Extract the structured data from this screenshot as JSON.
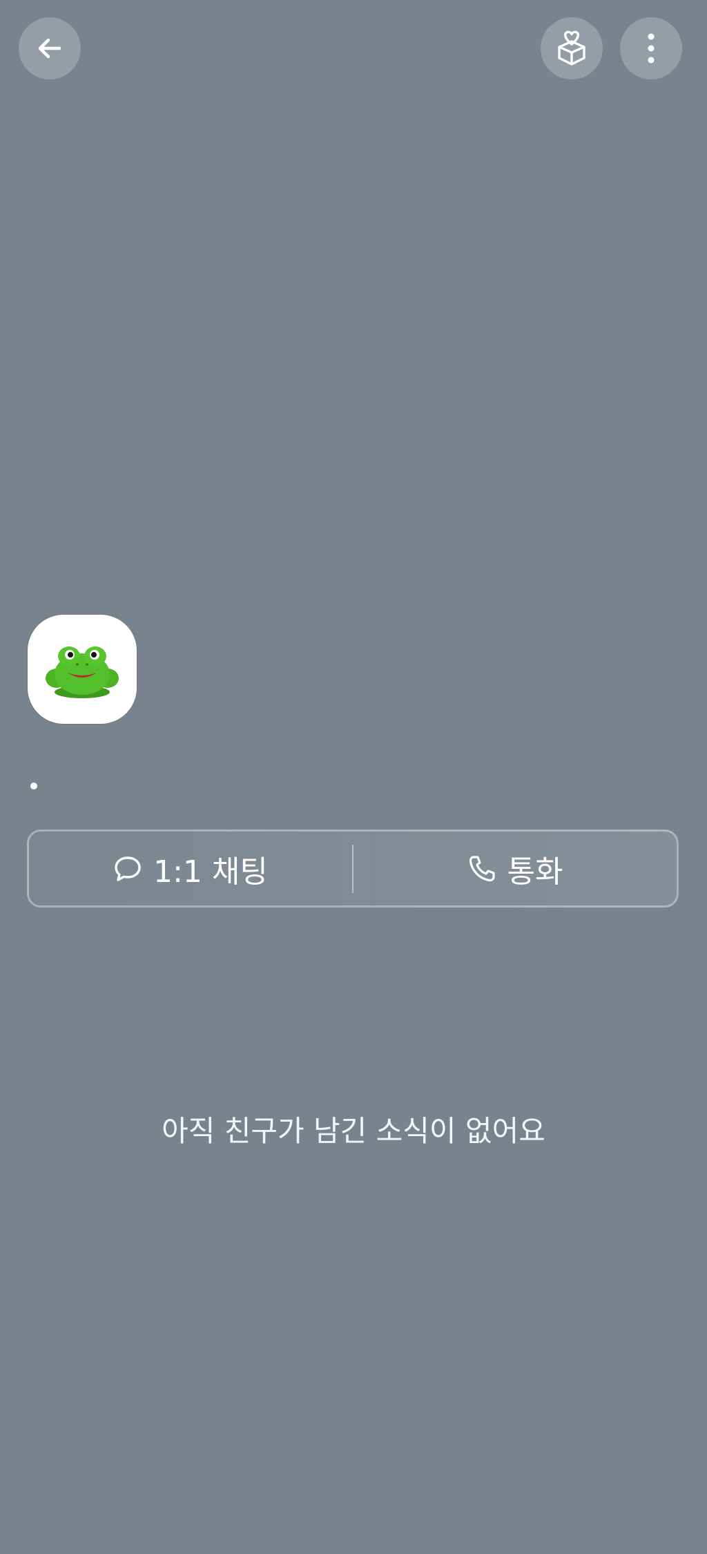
{
  "header": {
    "back_icon": "arrow-left-icon",
    "gift_icon": "heart-gift-box-icon",
    "more_icon": "vertical-dots-icon"
  },
  "profile": {
    "avatar_icon": "frog-icon",
    "status_message": "."
  },
  "actions": {
    "chat_icon": "speech-bubble-icon",
    "chat_label": "1:1 채팅",
    "call_icon": "phone-icon",
    "call_label": "통화"
  },
  "feed": {
    "empty_message": "아직 친구가 남긴 소식이 없어요"
  },
  "colors": {
    "background": "#78838e",
    "frog_green": "#4bb324"
  }
}
